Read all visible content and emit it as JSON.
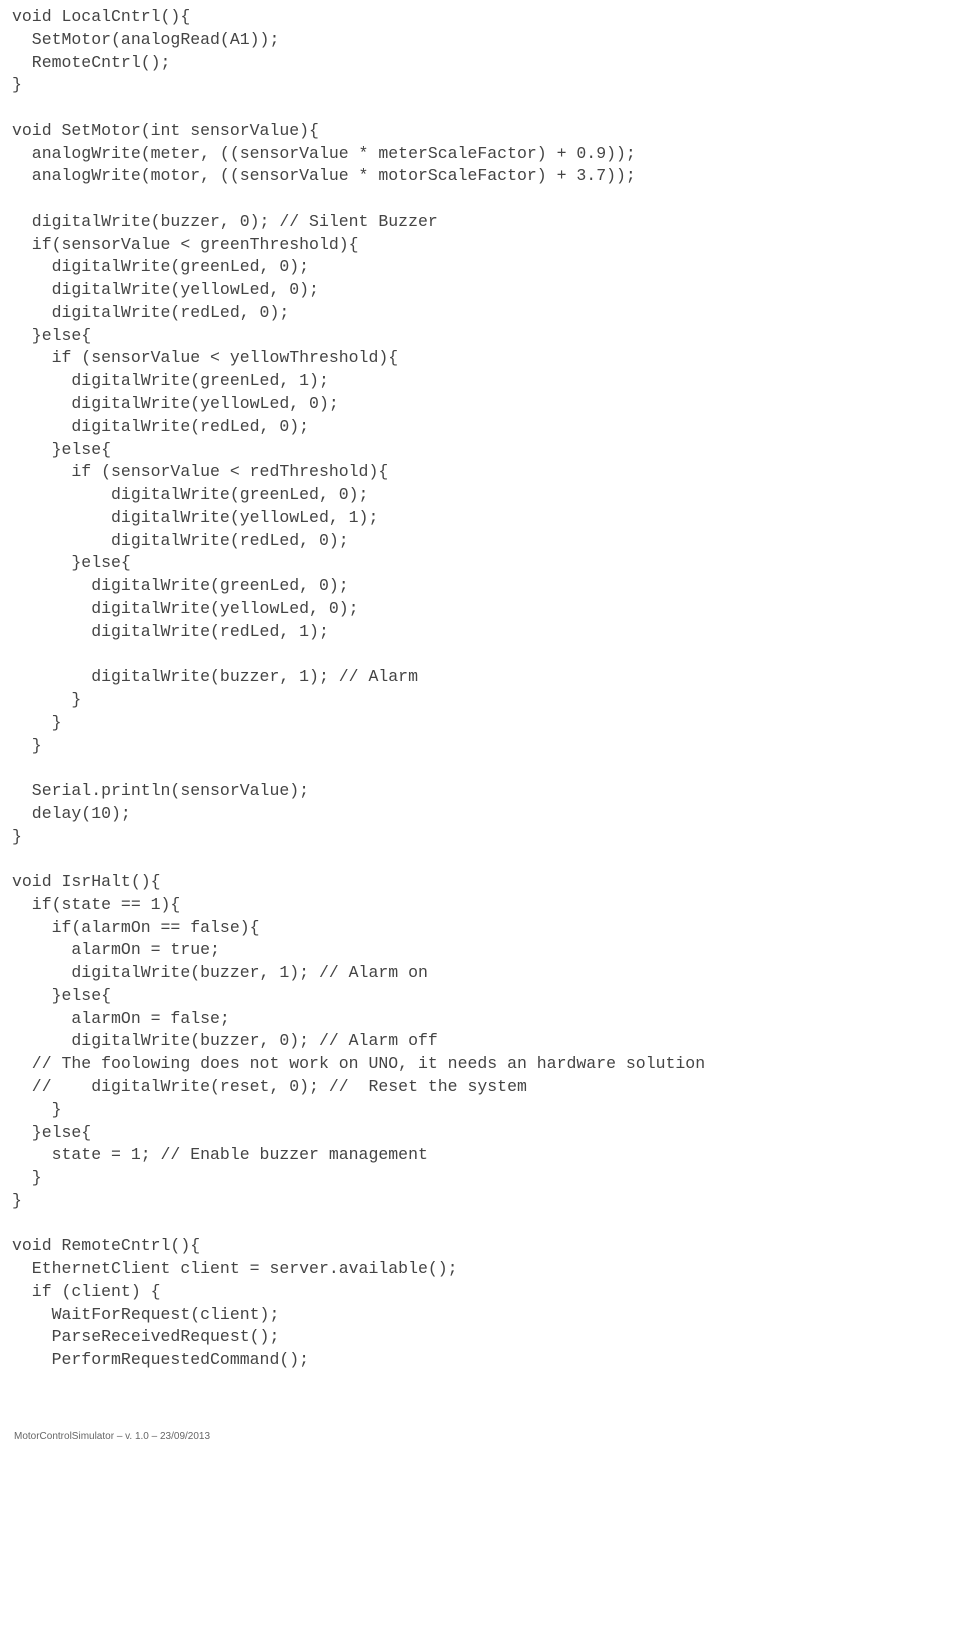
{
  "code": "void LocalCntrl(){\n  SetMotor(analogRead(A1));\n  RemoteCntrl();\n}\n\nvoid SetMotor(int sensorValue){\n  analogWrite(meter, ((sensorValue * meterScaleFactor) + 0.9));\n  analogWrite(motor, ((sensorValue * motorScaleFactor) + 3.7));\n\n  digitalWrite(buzzer, 0); // Silent Buzzer\n  if(sensorValue < greenThreshold){\n    digitalWrite(greenLed, 0);\n    digitalWrite(yellowLed, 0);\n    digitalWrite(redLed, 0);\n  }else{\n    if (sensorValue < yellowThreshold){\n      digitalWrite(greenLed, 1);\n      digitalWrite(yellowLed, 0);\n      digitalWrite(redLed, 0);\n    }else{\n      if (sensorValue < redThreshold){\n          digitalWrite(greenLed, 0);\n          digitalWrite(yellowLed, 1);\n          digitalWrite(redLed, 0);\n      }else{\n        digitalWrite(greenLed, 0);\n        digitalWrite(yellowLed, 0);\n        digitalWrite(redLed, 1);\n\n        digitalWrite(buzzer, 1); // Alarm\n      }\n    }\n  }\n\n  Serial.println(sensorValue);\n  delay(10);\n}\n\nvoid IsrHalt(){\n  if(state == 1){\n    if(alarmOn == false){\n      alarmOn = true;\n      digitalWrite(buzzer, 1); // Alarm on\n    }else{\n      alarmOn = false;\n      digitalWrite(buzzer, 0); // Alarm off\n  // The foolowing does not work on UNO, it needs an hardware solution\n  //    digitalWrite(reset, 0); //  Reset the system\n    }\n  }else{\n    state = 1; // Enable buzzer management\n  }\n}\n\nvoid RemoteCntrl(){\n  EthernetClient client = server.available();\n  if (client) {\n    WaitForRequest(client);\n    ParseReceivedRequest();\n    PerformRequestedCommand();",
  "footer": "MotorControlSimulator – v.  1.0 – 23/09/2013"
}
